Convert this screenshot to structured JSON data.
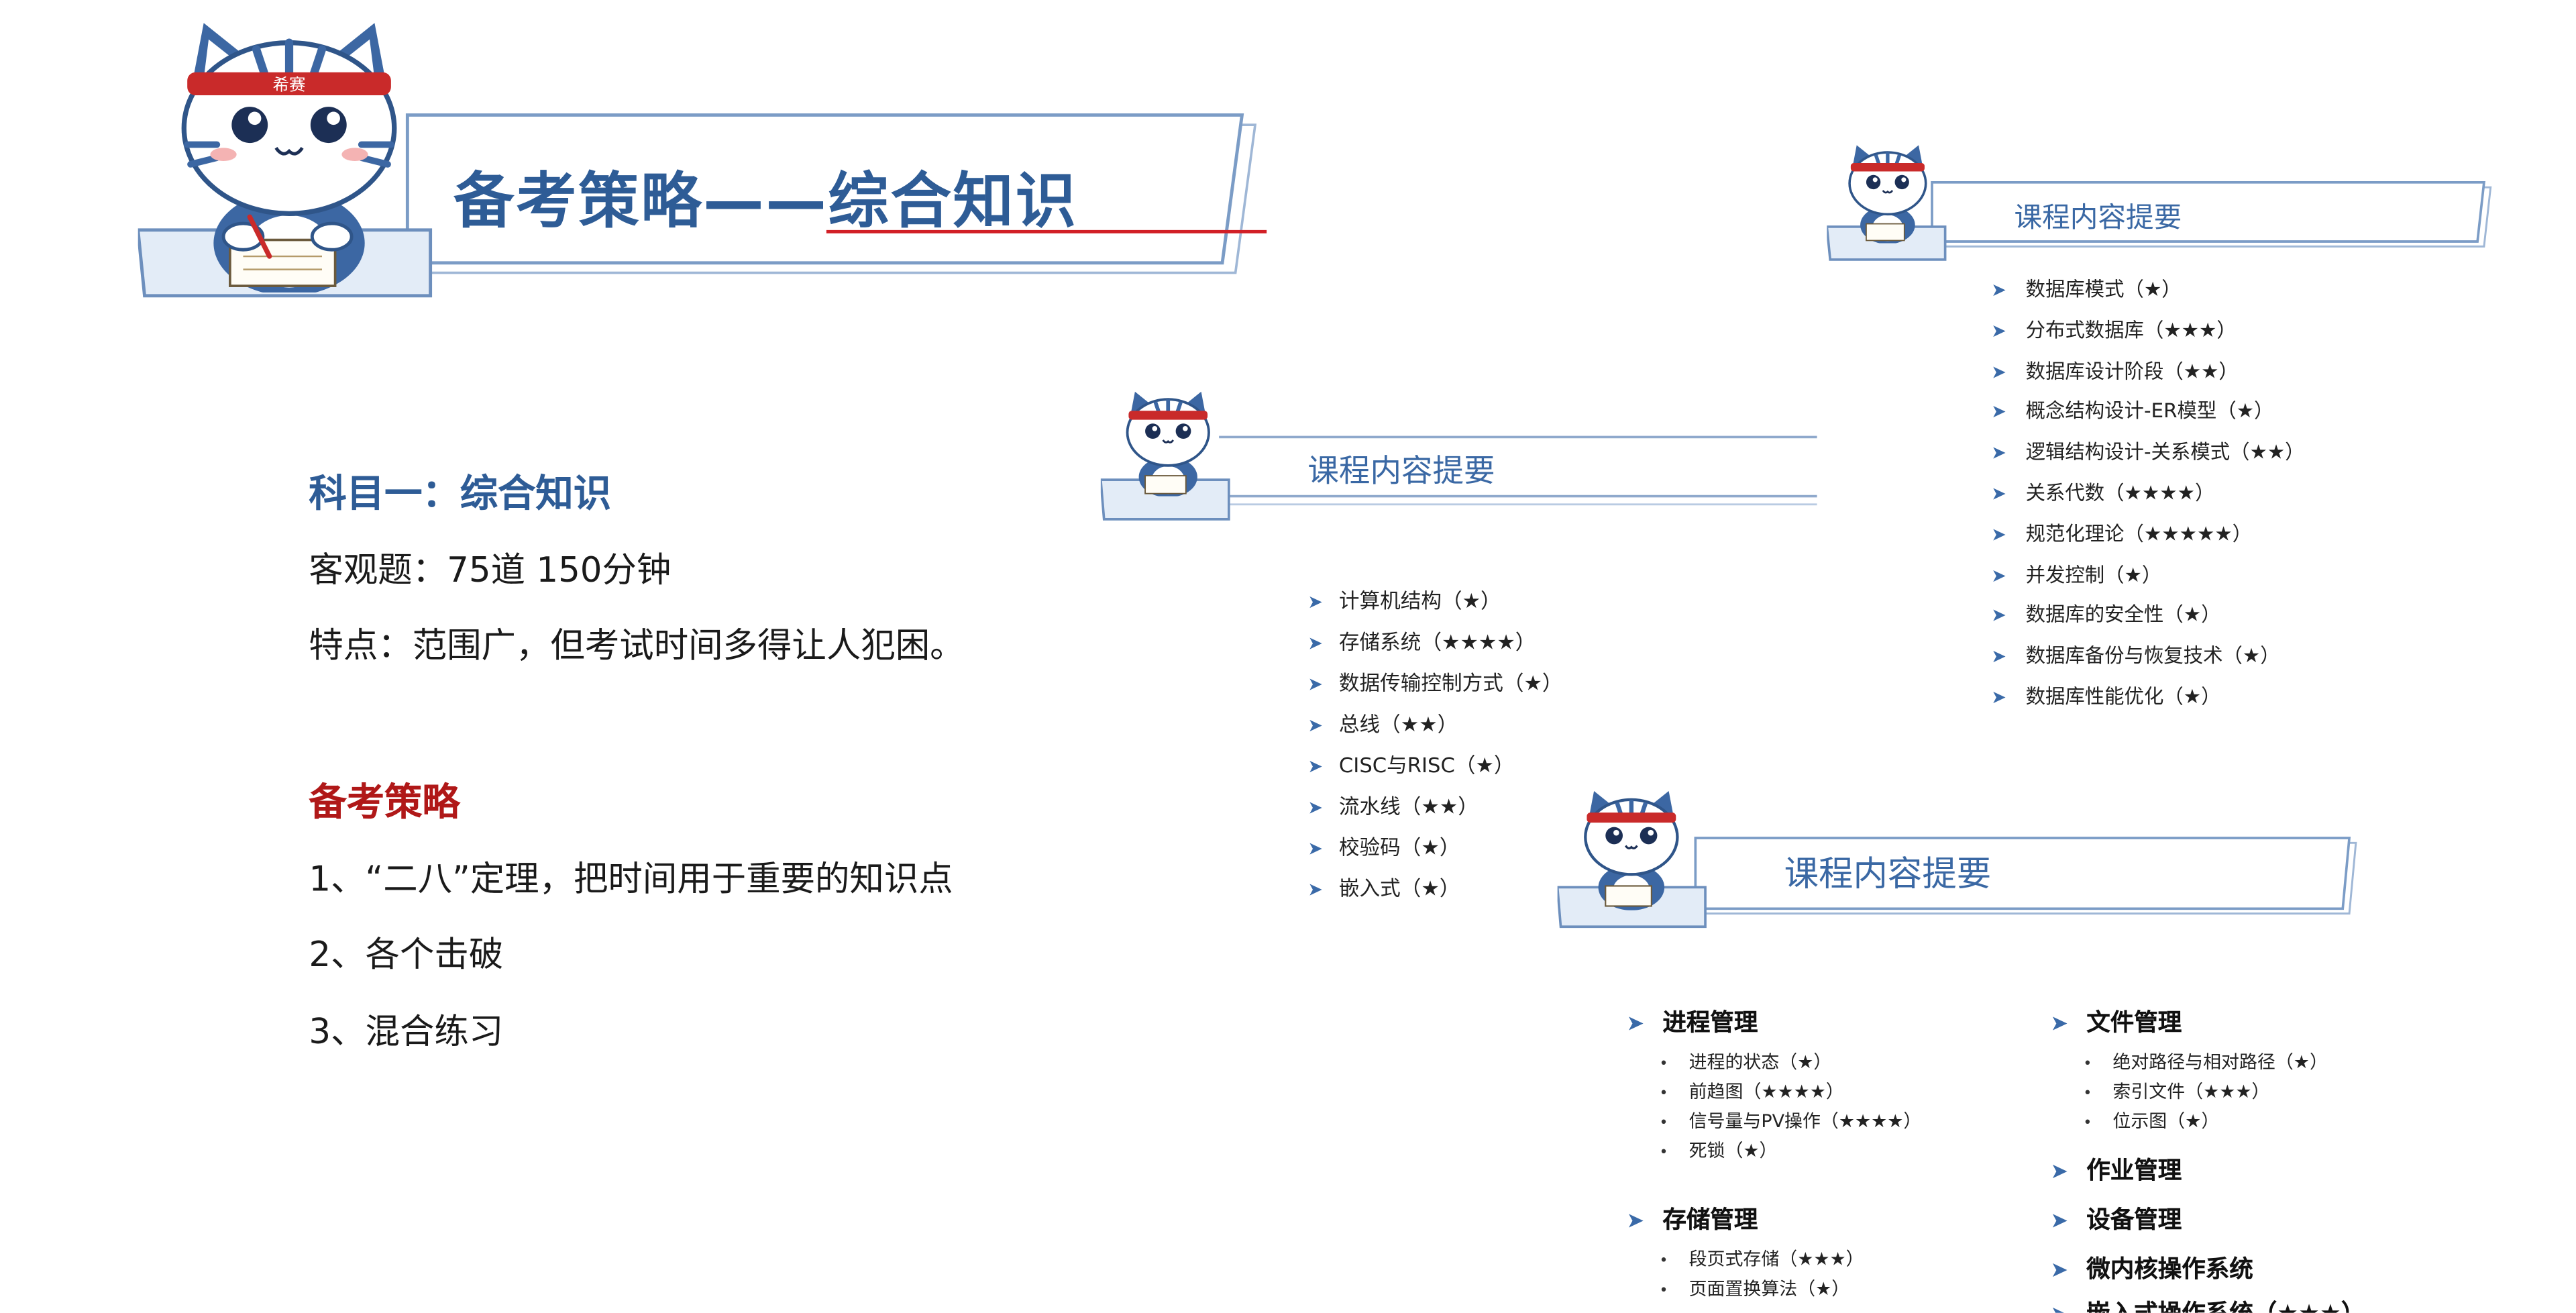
{
  "title": {
    "prefix": "备考策略——",
    "highlight": "综合知识"
  },
  "mascot": {
    "headband_text": "希赛"
  },
  "left": {
    "subject_title": "科目一：综合知识",
    "objective": "客观题：75道   150分钟",
    "feature": "特点：范围广，但考试时间多得让人犯困。",
    "strategy_title": "备考策略",
    "strategies": [
      "1、“二八”定理，把时间用于重要的知识点",
      "2、各个击破",
      "3、混合练习"
    ]
  },
  "banner_label": "课程内容提要",
  "computer_topics": [
    "计算机结构（★）",
    "存储系统（★★★★）",
    "数据传输控制方式（★）",
    "总线（★★）",
    "CISC与RISC（★）",
    "流水线（★★）",
    "校验码（★）",
    "嵌入式（★）"
  ],
  "database_topics": [
    "数据库模式（★）",
    "分布式数据库（★★★）",
    "数据库设计阶段（★★）",
    "概念结构设计-ER模型（★）",
    "逻辑结构设计-关系模式（★★）",
    "关系代数（★★★★）",
    "规范化理论（★★★★★）",
    "并发控制（★）",
    "数据库的安全性（★）",
    "数据库备份与恢复技术（★）",
    "数据库性能优化（★）"
  ],
  "os_topics": {
    "process": {
      "title": "进程管理",
      "items": [
        "进程的状态（★）",
        "前趋图（★★★★）",
        "信号量与PV操作（★★★★）",
        "死锁（★）"
      ]
    },
    "storage": {
      "title": "存储管理",
      "items": [
        "段页式存储（★★★）",
        "页面置换算法（★）"
      ]
    },
    "file": {
      "title": "文件管理",
      "items": [
        "绝对路径与相对路径（★）",
        "索引文件（★★★）",
        "位示图（★）"
      ]
    },
    "job": {
      "title": "作业管理"
    },
    "device": {
      "title": "设备管理"
    },
    "microkernel": {
      "title": "微内核操作系统"
    },
    "embedded": {
      "title": "嵌入式操作系统（★★★）"
    }
  },
  "colors": {
    "primary_blue": "#2e5c96",
    "accent_red": "#d21f26",
    "strategy_red": "#b01818"
  },
  "icons": {
    "bullet": "chevron-right-icon",
    "mascot": "cat-mascot-icon"
  }
}
